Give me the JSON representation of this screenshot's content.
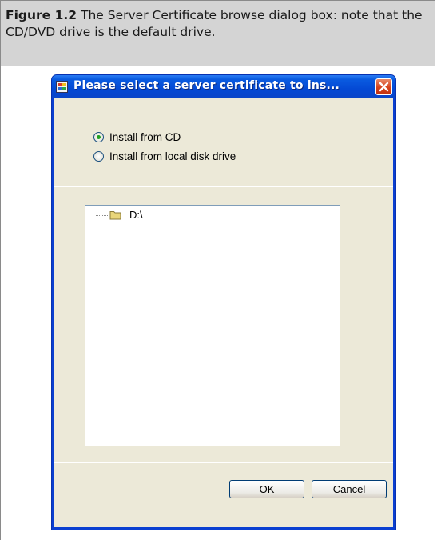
{
  "caption": {
    "label": "Figure 1.2",
    "text": "The Server Certificate browse dialog box: note that the CD/DVD drive is the default drive."
  },
  "dialog": {
    "title": "Please select a server certificate to ins...",
    "options": [
      {
        "label": "Install from CD",
        "checked": true
      },
      {
        "label": "Install from local disk drive",
        "checked": false
      }
    ],
    "tree": {
      "items": [
        {
          "label": "D:\\",
          "icon": "folder-icon"
        }
      ]
    },
    "buttons": {
      "ok": "OK",
      "cancel": "Cancel"
    }
  },
  "colors": {
    "titlebar": "#0a5be0",
    "close": "#d6421c",
    "dialog_bg": "#ece9d8"
  }
}
